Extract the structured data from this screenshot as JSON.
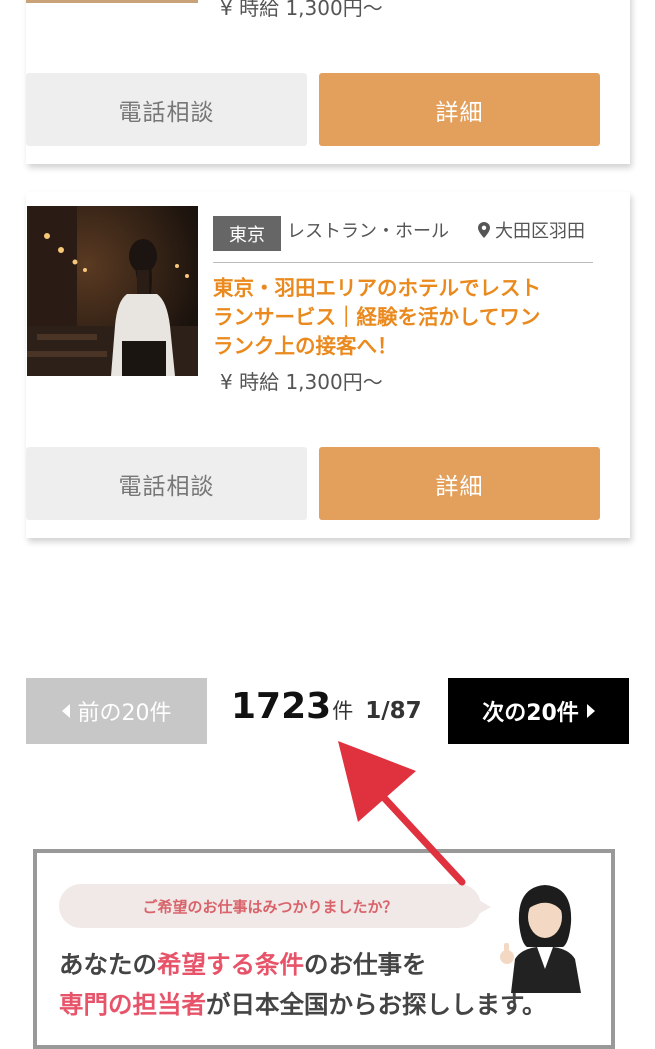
{
  "listing_prev": {
    "price": "¥ 時給 1,300円〜",
    "phone_button": "電話相談",
    "detail_button": "詳細"
  },
  "listing": {
    "image_description": "waitress-photo",
    "region_tag": "東京",
    "category": "レストラン・ホール",
    "location": "大田区羽田",
    "title_lines": [
      "東京・羽田エリアのホテルでレスト",
      "ランサービス｜経験を活かしてワン",
      "ランク上の接客へ！"
    ],
    "price": "¥ 時給 1,300円〜",
    "phone_button": "電話相談",
    "detail_button": "詳細"
  },
  "pagination": {
    "prev_label": "前の20件",
    "total_count": "1723",
    "count_unit": "件",
    "page_indicator": "1/87",
    "next_label": "次の20件"
  },
  "banner": {
    "bubble_text": "ご希望のお仕事はみつかりましたか？",
    "line1_a": "あなたの",
    "line1_b": "希望する条件",
    "line1_c": "のお仕事を",
    "line2_a": "専門の担当者",
    "line2_b": "が日本全国からお探しします。"
  },
  "colors": {
    "accent_orange": "#e3a05c",
    "title_orange": "#ea8a1e",
    "annotation_red": "#e0323e",
    "highlight_pink": "#e7546a"
  }
}
